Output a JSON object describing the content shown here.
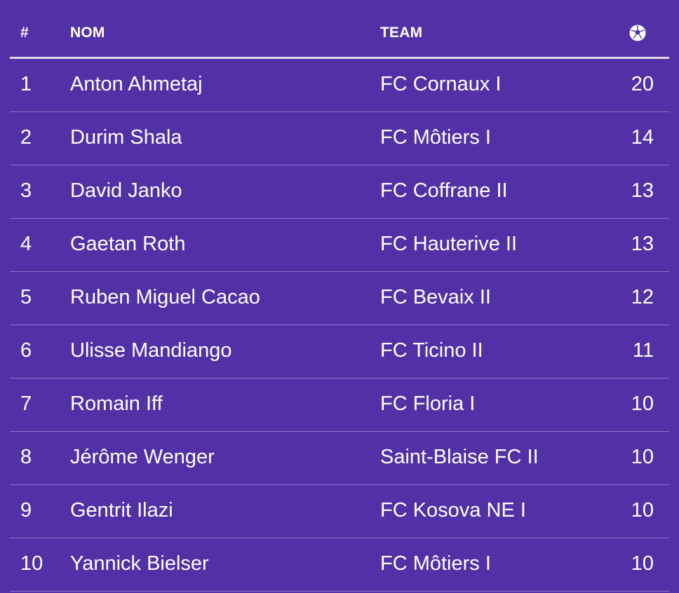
{
  "table": {
    "headers": {
      "rank": "#",
      "name": "NOM",
      "team": "TEAM",
      "goals_icon": "soccer-ball-icon"
    },
    "rows": [
      {
        "rank": "1",
        "name": "Anton Ahmetaj",
        "team": "FC Cornaux I",
        "goals": "20"
      },
      {
        "rank": "2",
        "name": "Durim Shala",
        "team": "FC Môtiers I",
        "goals": "14"
      },
      {
        "rank": "3",
        "name": "David Janko",
        "team": "FC Coffrane II",
        "goals": "13"
      },
      {
        "rank": "4",
        "name": "Gaetan Roth",
        "team": "FC Hauterive II",
        "goals": "13"
      },
      {
        "rank": "5",
        "name": "Ruben Miguel Cacao",
        "team": "FC Bevaix II",
        "goals": "12"
      },
      {
        "rank": "6",
        "name": "Ulisse Mandiango",
        "team": "FC Ticino II",
        "goals": "11"
      },
      {
        "rank": "7",
        "name": "Romain Iff",
        "team": "FC Floria I",
        "goals": "10"
      },
      {
        "rank": "8",
        "name": "Jérôme Wenger",
        "team": "Saint-Blaise FC II",
        "goals": "10"
      },
      {
        "rank": "9",
        "name": "Gentrit Ilazi",
        "team": "FC Kosova NE I",
        "goals": "10"
      },
      {
        "rank": "10",
        "name": "Yannick Bielser",
        "team": "FC Môtiers I",
        "goals": "10"
      }
    ]
  },
  "colors": {
    "background": "#5430a6",
    "text": "#ffffff"
  }
}
